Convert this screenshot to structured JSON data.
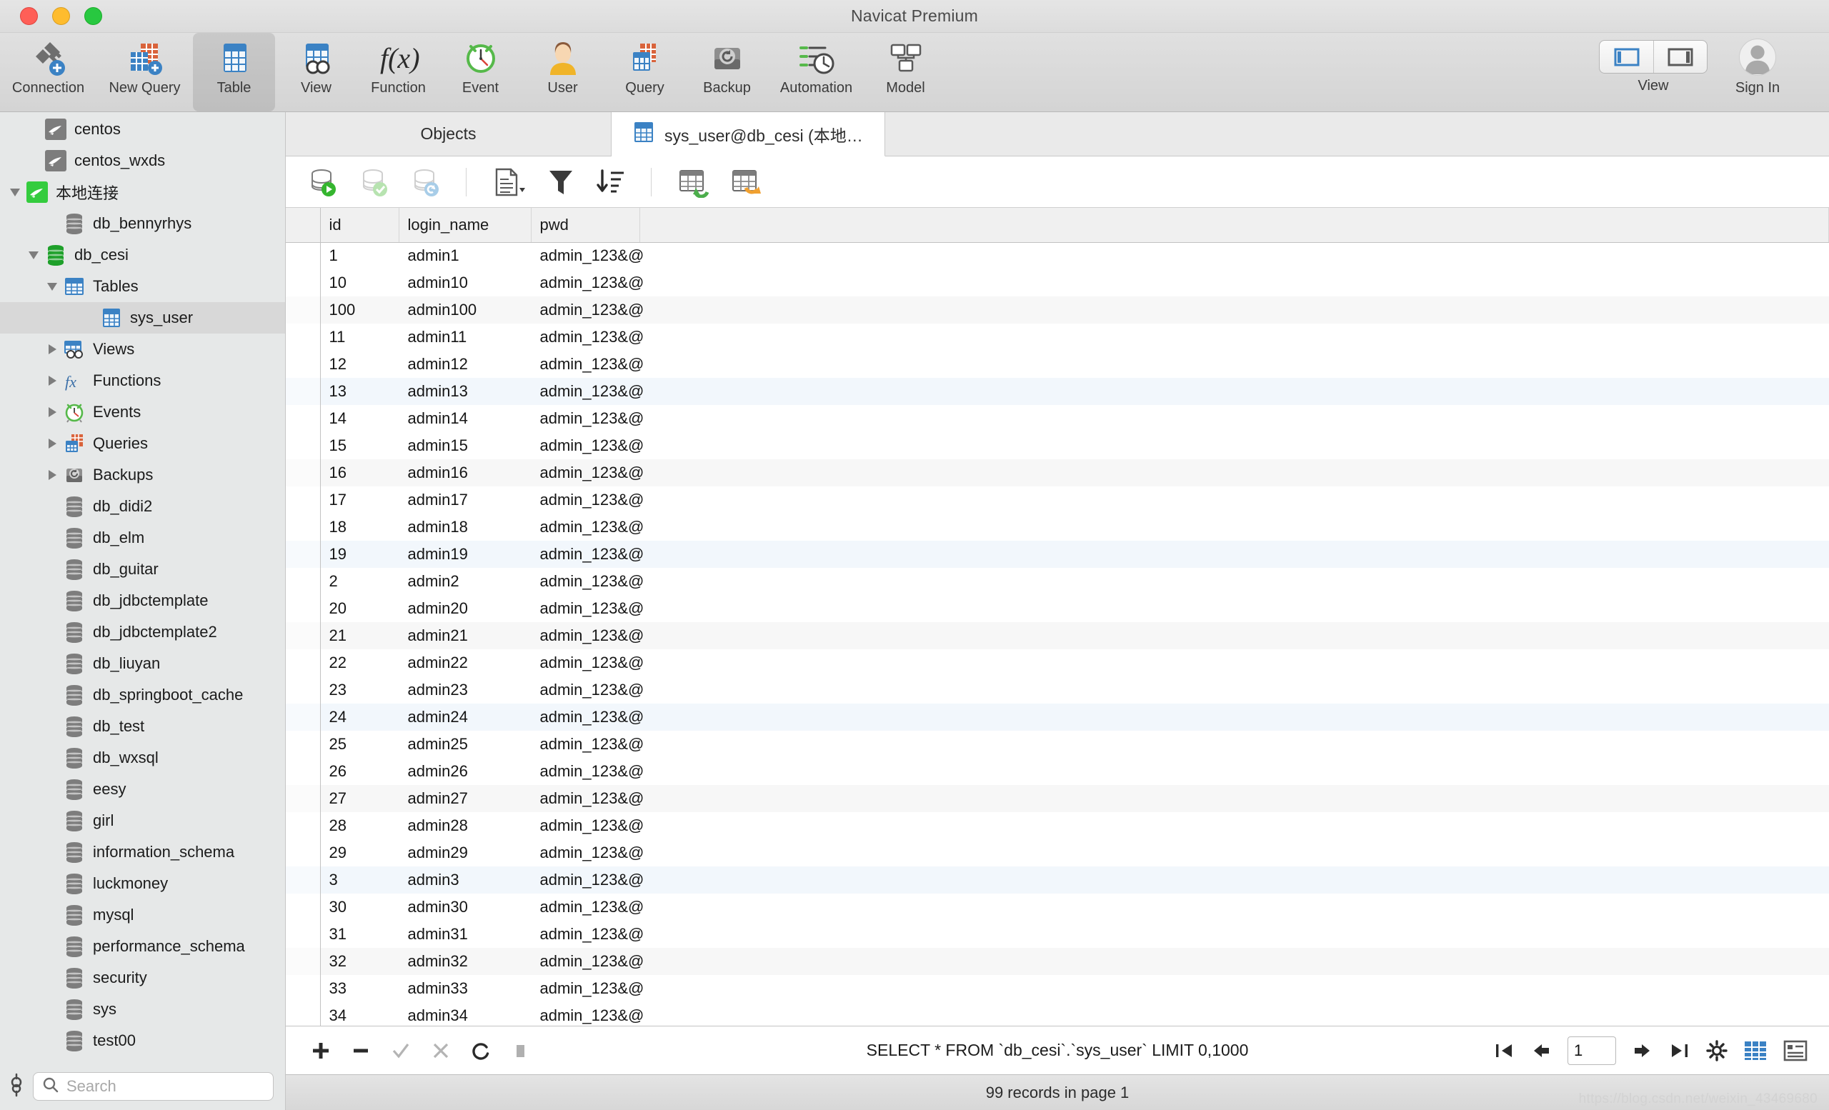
{
  "window": {
    "title": "Navicat Premium",
    "traffic_lights": [
      "close",
      "minimize",
      "zoom"
    ]
  },
  "toolbar": {
    "items": [
      {
        "label": "Connection",
        "icon": "connection-icon"
      },
      {
        "label": "New Query",
        "icon": "new-query-icon"
      },
      {
        "label": "Table",
        "icon": "table-icon",
        "active": true
      },
      {
        "label": "View",
        "icon": "view-icon"
      },
      {
        "label": "Function",
        "icon": "function-icon"
      },
      {
        "label": "Event",
        "icon": "event-icon"
      },
      {
        "label": "User",
        "icon": "user-icon"
      },
      {
        "label": "Query",
        "icon": "query-icon"
      },
      {
        "label": "Backup",
        "icon": "backup-icon"
      },
      {
        "label": "Automation",
        "icon": "automation-icon"
      },
      {
        "label": "Model",
        "icon": "model-icon"
      }
    ],
    "view_toggle_label": "View",
    "sign_in_label": "Sign In"
  },
  "sidebar": {
    "search_placeholder": "Search",
    "items": [
      {
        "label": "centos",
        "icon": "mysql-connection-icon",
        "indent": 1,
        "twisty": "none",
        "selected": false
      },
      {
        "label": "centos_wxds",
        "icon": "mysql-connection-icon",
        "indent": 1,
        "twisty": "none",
        "selected": false
      },
      {
        "label": "本地连接",
        "icon": "mysql-connection-open-icon",
        "indent": 0,
        "twisty": "down",
        "selected": false
      },
      {
        "label": "db_bennyrhys",
        "icon": "database-icon",
        "indent": 2,
        "twisty": "none",
        "selected": false
      },
      {
        "label": "db_cesi",
        "icon": "database-open-icon",
        "indent": 1,
        "twisty": "down",
        "selected": false
      },
      {
        "label": "Tables",
        "icon": "tables-folder-icon",
        "indent": 2,
        "twisty": "down",
        "selected": false
      },
      {
        "label": "sys_user",
        "icon": "table-icon",
        "indent": 4,
        "twisty": "none",
        "selected": true
      },
      {
        "label": "Views",
        "icon": "views-folder-icon",
        "indent": 2,
        "twisty": "right",
        "selected": false
      },
      {
        "label": "Functions",
        "icon": "functions-folder-icon",
        "indent": 2,
        "twisty": "right",
        "selected": false
      },
      {
        "label": "Events",
        "icon": "events-folder-icon",
        "indent": 2,
        "twisty": "right",
        "selected": false
      },
      {
        "label": "Queries",
        "icon": "queries-folder-icon",
        "indent": 2,
        "twisty": "right",
        "selected": false
      },
      {
        "label": "Backups",
        "icon": "backups-folder-icon",
        "indent": 2,
        "twisty": "right",
        "selected": false
      },
      {
        "label": "db_didi2",
        "icon": "database-icon",
        "indent": 2,
        "twisty": "none",
        "selected": false
      },
      {
        "label": "db_elm",
        "icon": "database-icon",
        "indent": 2,
        "twisty": "none",
        "selected": false
      },
      {
        "label": "db_guitar",
        "icon": "database-icon",
        "indent": 2,
        "twisty": "none",
        "selected": false
      },
      {
        "label": "db_jdbctemplate",
        "icon": "database-icon",
        "indent": 2,
        "twisty": "none",
        "selected": false
      },
      {
        "label": "db_jdbctemplate2",
        "icon": "database-icon",
        "indent": 2,
        "twisty": "none",
        "selected": false
      },
      {
        "label": "db_liuyan",
        "icon": "database-icon",
        "indent": 2,
        "twisty": "none",
        "selected": false
      },
      {
        "label": "db_springboot_cache",
        "icon": "database-icon",
        "indent": 2,
        "twisty": "none",
        "selected": false
      },
      {
        "label": "db_test",
        "icon": "database-icon",
        "indent": 2,
        "twisty": "none",
        "selected": false
      },
      {
        "label": "db_wxsql",
        "icon": "database-icon",
        "indent": 2,
        "twisty": "none",
        "selected": false
      },
      {
        "label": "eesy",
        "icon": "database-icon",
        "indent": 2,
        "twisty": "none",
        "selected": false
      },
      {
        "label": "girl",
        "icon": "database-icon",
        "indent": 2,
        "twisty": "none",
        "selected": false
      },
      {
        "label": "information_schema",
        "icon": "database-icon",
        "indent": 2,
        "twisty": "none",
        "selected": false
      },
      {
        "label": "luckmoney",
        "icon": "database-icon",
        "indent": 2,
        "twisty": "none",
        "selected": false
      },
      {
        "label": "mysql",
        "icon": "database-icon",
        "indent": 2,
        "twisty": "none",
        "selected": false
      },
      {
        "label": "performance_schema",
        "icon": "database-icon",
        "indent": 2,
        "twisty": "none",
        "selected": false
      },
      {
        "label": "security",
        "icon": "database-icon",
        "indent": 2,
        "twisty": "none",
        "selected": false
      },
      {
        "label": "sys",
        "icon": "database-icon",
        "indent": 2,
        "twisty": "none",
        "selected": false
      },
      {
        "label": "test00",
        "icon": "database-icon",
        "indent": 2,
        "twisty": "none",
        "selected": false
      }
    ]
  },
  "tabs": [
    {
      "label": "Objects",
      "icon": "none",
      "active": false
    },
    {
      "label": "sys_user@db_cesi (本地…",
      "icon": "table-icon",
      "active": true
    }
  ],
  "grid_toolbar": [
    {
      "name": "begin-transaction-icon"
    },
    {
      "name": "commit-icon"
    },
    {
      "name": "rollback-icon"
    },
    {
      "name": "separator"
    },
    {
      "name": "note-icon"
    },
    {
      "name": "filter-icon"
    },
    {
      "name": "sort-icon"
    },
    {
      "name": "separator"
    },
    {
      "name": "import-wizard-icon"
    },
    {
      "name": "export-wizard-icon"
    }
  ],
  "table": {
    "columns": [
      "id",
      "login_name",
      "pwd"
    ],
    "rows": [
      [
        "1",
        "admin1",
        "admin_123&@"
      ],
      [
        "10",
        "admin10",
        "admin_123&@"
      ],
      [
        "100",
        "admin100",
        "admin_123&@"
      ],
      [
        "11",
        "admin11",
        "admin_123&@"
      ],
      [
        "12",
        "admin12",
        "admin_123&@"
      ],
      [
        "13",
        "admin13",
        "admin_123&@"
      ],
      [
        "14",
        "admin14",
        "admin_123&@"
      ],
      [
        "15",
        "admin15",
        "admin_123&@"
      ],
      [
        "16",
        "admin16",
        "admin_123&@"
      ],
      [
        "17",
        "admin17",
        "admin_123&@"
      ],
      [
        "18",
        "admin18",
        "admin_123&@"
      ],
      [
        "19",
        "admin19",
        "admin_123&@"
      ],
      [
        "2",
        "admin2",
        "admin_123&@"
      ],
      [
        "20",
        "admin20",
        "admin_123&@"
      ],
      [
        "21",
        "admin21",
        "admin_123&@"
      ],
      [
        "22",
        "admin22",
        "admin_123&@"
      ],
      [
        "23",
        "admin23",
        "admin_123&@"
      ],
      [
        "24",
        "admin24",
        "admin_123&@"
      ],
      [
        "25",
        "admin25",
        "admin_123&@"
      ],
      [
        "26",
        "admin26",
        "admin_123&@"
      ],
      [
        "27",
        "admin27",
        "admin_123&@"
      ],
      [
        "28",
        "admin28",
        "admin_123&@"
      ],
      [
        "29",
        "admin29",
        "admin_123&@"
      ],
      [
        "3",
        "admin3",
        "admin_123&@"
      ],
      [
        "30",
        "admin30",
        "admin_123&@"
      ],
      [
        "31",
        "admin31",
        "admin_123&@"
      ],
      [
        "32",
        "admin32",
        "admin_123&@"
      ],
      [
        "33",
        "admin33",
        "admin_123&@"
      ],
      [
        "34",
        "admin34",
        "admin_123&@"
      ]
    ]
  },
  "editbar": {
    "sql": "SELECT * FROM `db_cesi`.`sys_user` LIMIT 0,1000",
    "page_value": "1",
    "buttons": [
      "add-record-icon",
      "delete-record-icon",
      "apply-change-icon",
      "discard-change-icon",
      "refresh-icon",
      "stop-icon"
    ],
    "nav_buttons": [
      "first-page-icon",
      "previous-page-icon",
      "next-page-icon",
      "last-page-icon",
      "settings-icon",
      "grid-view-icon",
      "form-view-icon"
    ]
  },
  "statusbar": {
    "text": "99 records in page 1",
    "watermark": "https://blog.csdn.net/weixin_43469680"
  },
  "colors": {
    "accent_blue": "#3b82c4",
    "green": "#35c040",
    "orange": "#d9633b",
    "row_grey": "#f7f7f7",
    "row_blue": "#f2f7fc"
  }
}
